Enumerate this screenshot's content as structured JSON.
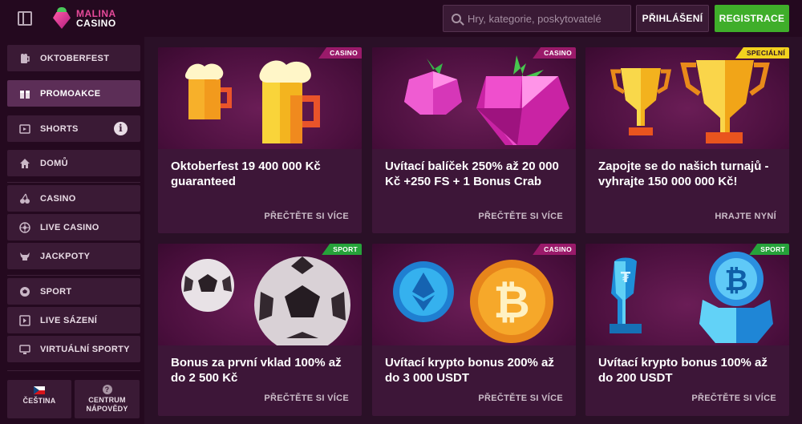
{
  "header": {
    "logo_line1": "MALINA",
    "logo_line2": "CASINO",
    "search_placeholder": "Hry, kategorie, poskytovatelé",
    "login_label": "PŘIHLÁŠENÍ",
    "register_label": "REGISTRACE"
  },
  "sidebar": {
    "items": [
      {
        "label": "OKTOBERFEST",
        "icon": "beer-icon"
      },
      {
        "label": "PROMOAKCE",
        "icon": "gift-icon"
      },
      {
        "label": "SHORTS",
        "icon": "video-icon"
      },
      {
        "label": "DOMŮ",
        "icon": "home-icon"
      },
      {
        "label": "CASINO",
        "icon": "cherries-icon"
      },
      {
        "label": "LIVE CASINO",
        "icon": "roulette-icon"
      },
      {
        "label": "JACKPOTY",
        "icon": "bull-icon"
      },
      {
        "label": "SPORT",
        "icon": "football-icon"
      },
      {
        "label": "LIVE SÁZENÍ",
        "icon": "live-bet-icon"
      },
      {
        "label": "VIRTUÁLNÍ SPORTY",
        "icon": "monitor-icon"
      }
    ],
    "language_label": "ČEŠTINA",
    "help_line1": "CENTRUM",
    "help_line2": "NÁPOVĚDY"
  },
  "cards": [
    {
      "badge": "CASINO",
      "title": "Oktoberfest 19 400 000 Kč guaranteed",
      "action": "PŘEČTĚTE SI VÍCE"
    },
    {
      "badge": "CASINO",
      "title": "Uvítací balíček 250% až 20 000 Kč +250 FS + 1 Bonus Crab",
      "action": "PŘEČTĚTE SI VÍCE"
    },
    {
      "badge": "SPECIÁLNÍ",
      "title": "Zapojte se do našich turnajů - vyhrajte 150 000 000 Kč!",
      "action": "HRAJTE NYNÍ"
    },
    {
      "badge": "SPORT",
      "title": "Bonus za první vklad 100% až do 2 500 Kč",
      "action": "PŘEČTĚTE SI VÍCE"
    },
    {
      "badge": "CASINO",
      "title": "Uvítací krypto bonus 200% až do 3 000 USDT",
      "action": "PŘEČTĚTE SI VÍCE"
    },
    {
      "badge": "SPORT",
      "title": "Uvítací krypto bonus 100% až do 200 USDT",
      "action": "PŘEČTĚTE SI VÍCE"
    }
  ],
  "colors": {
    "background": "#2a1027",
    "panel": "#3a1a35",
    "register_green": "#3fae2a",
    "badge_casino": "#9a1a6a",
    "badge_special": "#f2d21e",
    "badge_sport": "#26a23a"
  }
}
